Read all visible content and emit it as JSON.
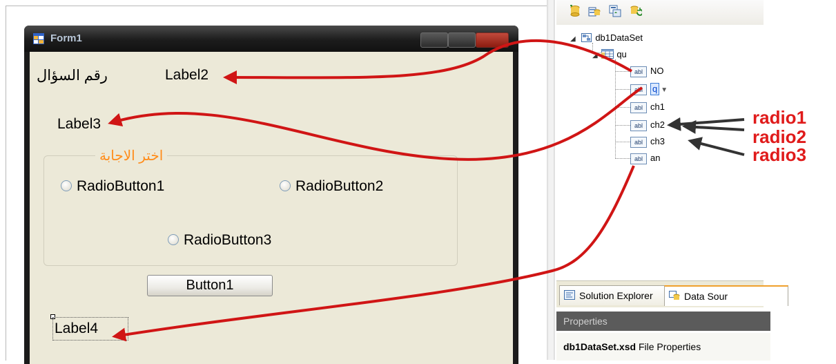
{
  "form": {
    "title": "Form1",
    "question_number_label": "رقم السؤال",
    "label2": "Label2",
    "label3": "Label3",
    "group_title": "اختر الاجابة",
    "radio_buttons": [
      "RadioButton1",
      "RadioButton2",
      "RadioButton3"
    ],
    "button1": "Button1",
    "label4": "Label4",
    "colors": {
      "group_title": "#ff8c1a",
      "client_bg": "#ece9d8"
    }
  },
  "data_sources": {
    "dataset": "db1DataSet",
    "table": "qu",
    "field_type_badge": "abl",
    "fields": [
      "NO",
      "q",
      "ch1",
      "ch2",
      "ch3",
      "an"
    ],
    "toolbar_icons": [
      "add-datasource-icon",
      "edit-dataset-icon",
      "configure-dataset-icon",
      "refresh-icon"
    ]
  },
  "bottom_tabs": [
    "Solution Explorer",
    "Data Sour"
  ],
  "properties": {
    "header": "Properties",
    "object_name": "db1DataSet.xsd",
    "object_type": "File Properties"
  },
  "annotations": {
    "labels": [
      "radio1",
      "radio2",
      "radio3"
    ],
    "colors": {
      "arrow": "#d01515",
      "label": "#e01b1b",
      "pointer": "#333333"
    }
  }
}
